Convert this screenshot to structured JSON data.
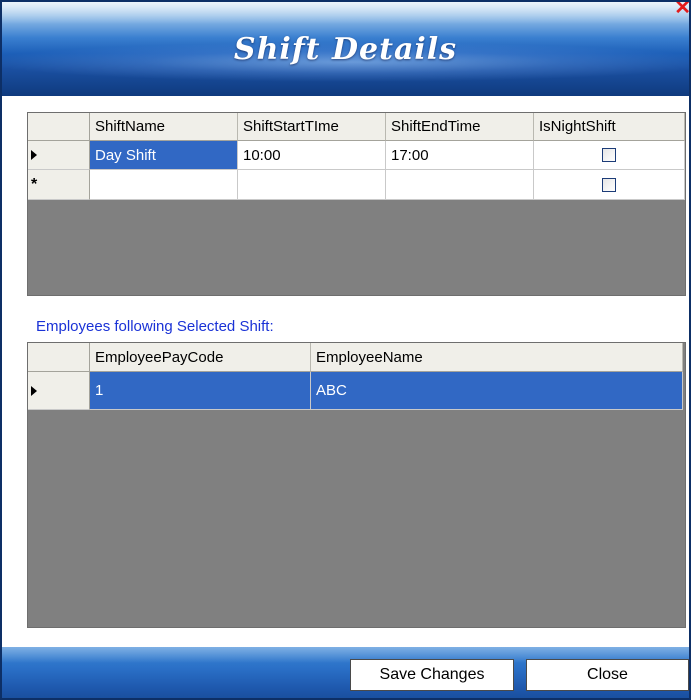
{
  "window": {
    "title": "Shift Details",
    "close_glyph": "✕"
  },
  "shifts_grid": {
    "columns": [
      "ShiftName",
      "ShiftStartTIme",
      "ShiftEndTime",
      "IsNightShift"
    ],
    "rows": [
      {
        "ShiftName": "Day Shift",
        "ShiftStartTIme": "10:00",
        "ShiftEndTime": "17:00",
        "IsNightShift": false,
        "selected": true
      }
    ],
    "new_row_glyph": "*"
  },
  "employees_section": {
    "label": "Employees following Selected Shift:"
  },
  "employees_grid": {
    "columns": [
      "EmployeePayCode",
      "EmployeeName"
    ],
    "rows": [
      {
        "EmployeePayCode": "1",
        "EmployeeName": "ABC",
        "selected": true
      }
    ]
  },
  "footer": {
    "save_label": "Save Changes",
    "close_label": "Close"
  },
  "colors": {
    "selection": "#3168c4",
    "grid_background": "#808080",
    "section_label": "#1a32d6",
    "close_x": "#e31b1b"
  }
}
